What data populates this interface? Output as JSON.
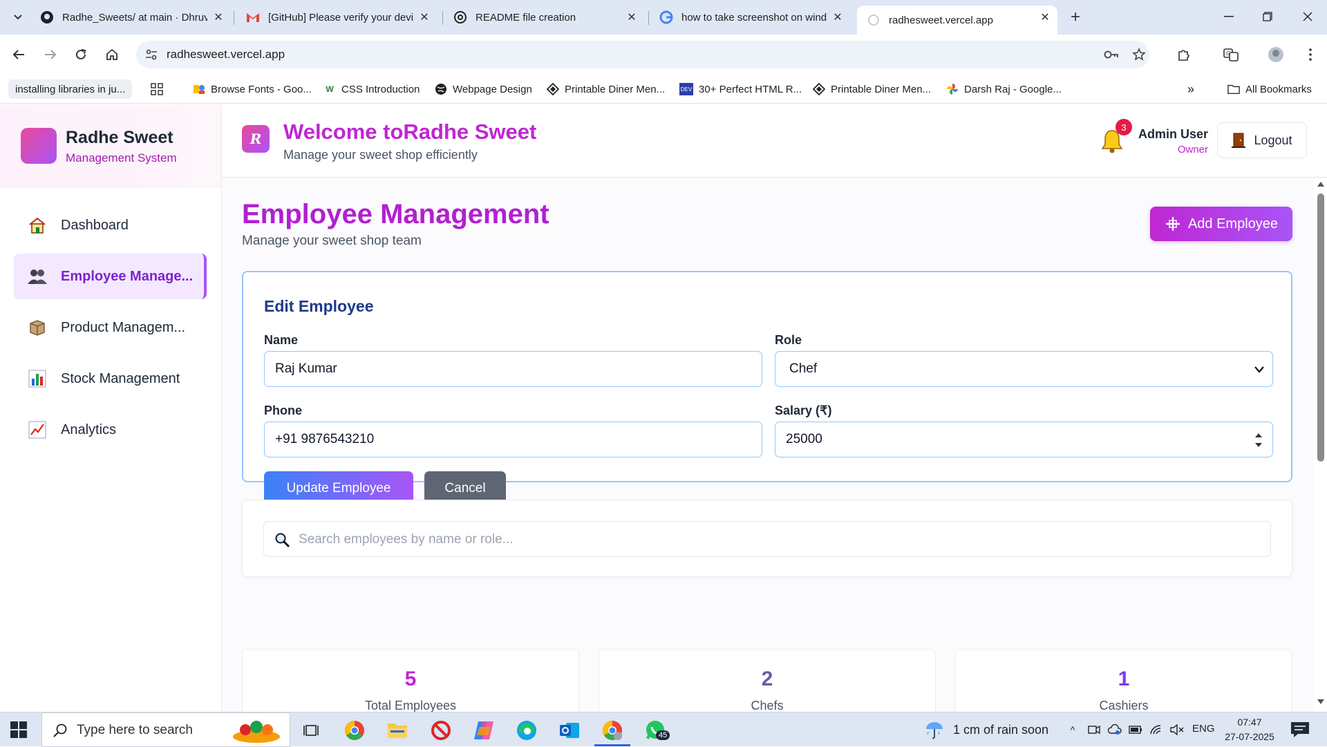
{
  "browser": {
    "tabs": [
      {
        "title": "Radhe_Sweets/ at main · Dhruv",
        "icon": "github-icon"
      },
      {
        "title": "[GitHub] Please verify your devi",
        "icon": "gmail-icon"
      },
      {
        "title": "README file creation",
        "icon": "openai-icon"
      },
      {
        "title": "how to take screenshot on wind",
        "icon": "google-icon"
      },
      {
        "title": "radhesweet.vercel.app",
        "icon": "loading-icon"
      }
    ],
    "url": "radhesweet.vercel.app",
    "bookmarks": [
      "installing libraries in ju...",
      "Browse Fonts - Goo...",
      "CSS Introduction",
      "Webpage Design",
      "Printable Diner Men...",
      "30+ Perfect HTML R...",
      "Printable Diner Men...",
      "Darsh Raj - Google...",
      "All Bookmarks"
    ]
  },
  "sidebar": {
    "brand_name": "Radhe Sweet",
    "brand_sub": "Management System",
    "items": [
      {
        "label": "Dashboard",
        "icon": "house-icon"
      },
      {
        "label": "Employee Manage...",
        "icon": "people-icon"
      },
      {
        "label": "Product Managem...",
        "icon": "box-icon"
      },
      {
        "label": "Stock Management",
        "icon": "bar-chart-icon"
      },
      {
        "label": "Analytics",
        "icon": "line-chart-icon"
      }
    ]
  },
  "header": {
    "logo_letter": "R",
    "title": "Welcome toRadhe Sweet",
    "subtitle": "Manage your sweet shop efficiently",
    "notification_count": "3",
    "user_name": "Admin User",
    "user_role": "Owner",
    "logout_label": "Logout"
  },
  "page": {
    "title": "Employee Management",
    "subtitle": "Manage your sweet shop team",
    "add_label": "Add Employee"
  },
  "edit_form": {
    "title": "Edit Employee",
    "name_label": "Name",
    "name_value": "Raj Kumar",
    "role_label": "Role",
    "role_value": "Chef",
    "phone_label": "Phone",
    "phone_value": "+91 9876543210",
    "salary_label": "Salary (₹)",
    "salary_value": "25000",
    "update_label": "Update Employee",
    "cancel_label": "Cancel"
  },
  "search": {
    "placeholder": "Search employees by name or role..."
  },
  "stats": [
    {
      "value": "5",
      "label": "Total Employees",
      "color": "#c026d3"
    },
    {
      "value": "2",
      "label": "Chefs",
      "color": "#6b5ca5"
    },
    {
      "value": "1",
      "label": "Cashiers",
      "color": "#7c3aed"
    }
  ],
  "taskbar": {
    "search_placeholder": "Type here to search",
    "whatsapp_badge": "45",
    "weather": "1 cm of rain soon",
    "lang": "ENG",
    "time": "07:47",
    "date": "27-07-2025"
  },
  "colors": {
    "accent": "#a855f7",
    "brand_pink": "#c026d3",
    "form_border": "#93c5fd"
  }
}
